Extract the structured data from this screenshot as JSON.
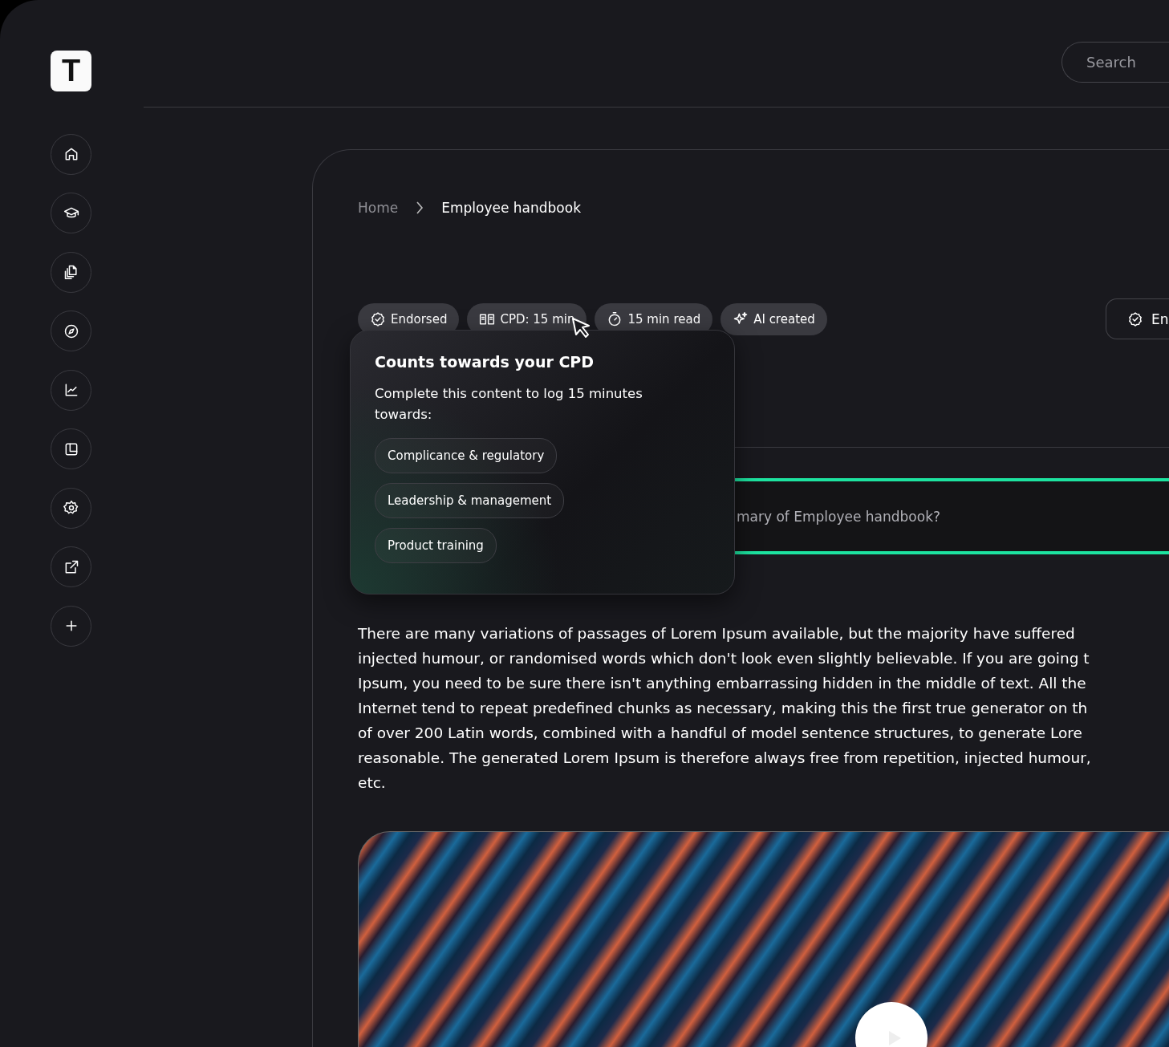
{
  "logo": "T",
  "search": {
    "placeholder": "Search"
  },
  "breadcrumb": [
    {
      "label": "Home",
      "current": false
    },
    {
      "label": "Employee handbook",
      "current": true
    }
  ],
  "chips": [
    {
      "kind": "endorsed",
      "label": "Endorsed"
    },
    {
      "kind": "cpd",
      "label": "CPD: 15 min"
    },
    {
      "kind": "read",
      "label": "15 min read"
    },
    {
      "kind": "ai",
      "label": "AI created"
    }
  ],
  "endorse_button": {
    "label": "En"
  },
  "tooltip": {
    "title": "Counts towards your CPD",
    "text": "Complete this content to log 15 minutes towards:",
    "topics": [
      "Complicance & regulatory",
      "Leadership & management",
      "Product training"
    ]
  },
  "summary_prompt": "mary of Employee handbook?",
  "article": {
    "lines": [
      "There are many variations of passages of Lorem Ipsum available, but the majority have suffered",
      "injected humour, or randomised words which don't look even slightly believable. If you are going t",
      "Ipsum, you need to be sure there isn't anything embarrassing hidden in the middle of text. All the",
      "Internet tend to repeat predefined chunks as necessary, making this the first true generator on th",
      "of over 200 Latin words, combined with a handful of model sentence structures, to generate Lore",
      "reasonable. The generated Lorem Ipsum is therefore always free from repetition, injected humour,",
      "etc."
    ]
  }
}
